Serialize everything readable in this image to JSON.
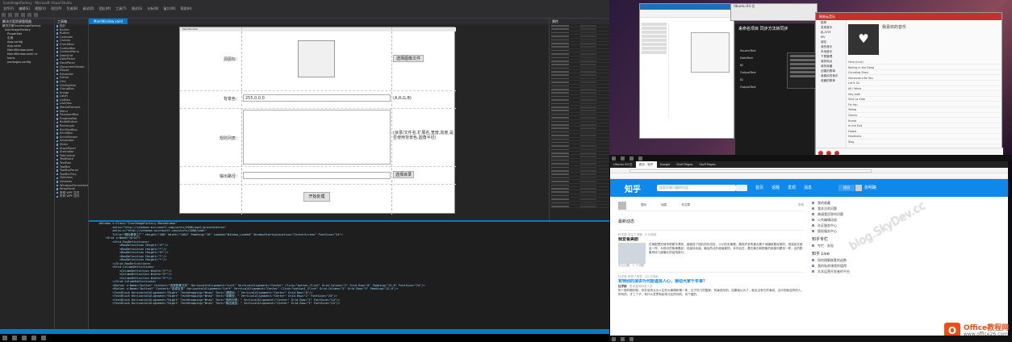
{
  "vs": {
    "title": "IconImageFactory - Microsoft Visual Studio",
    "menu": [
      "文件(F)",
      "编辑(E)",
      "视图(V)",
      "项目(P)",
      "生成(B)",
      "调试(D)",
      "团队(M)",
      "工具(T)",
      "测试(S)",
      "分析(N)",
      "窗口(W)",
      "帮助(H)"
    ],
    "solution_title": "解决方案资源管理器",
    "solution_items": [
      "解决方案'IconImageFactory'",
      "IconImageFactory",
      "Properties",
      "引用",
      "App.config",
      "App.xaml",
      "MainWindow.xaml",
      "MainWindow.xaml.cs",
      "Icons",
      "packages.config"
    ],
    "toolbox_title": "工具箱",
    "toolbox_items": [
      "指针",
      "Border",
      "Button",
      "Calendar",
      "Canvas",
      "CheckBox",
      "ComboBox",
      "ContextMenu",
      "DataGrid",
      "DatePicker",
      "DockPanel",
      "DocumentViewer",
      "Ellipse",
      "Expander",
      "Frame",
      "Grid",
      "GridSplitter",
      "GroupBox",
      "Image",
      "Label",
      "ListBox",
      "ListView",
      "MediaElement",
      "Menu",
      "PasswordBox",
      "ProgressBar",
      "RadioButton",
      "Rectangle",
      "RichTextBox",
      "ScrollBar",
      "ScrollViewer",
      "Separator",
      "Slider",
      "StackPanel",
      "StatusBar",
      "TabControl",
      "TextBlock",
      "TextBox",
      "ToolBar",
      "ToolBarPanel",
      "ToolBarTray",
      "TreeView",
      "Viewbox",
      "WindowsFormsHost",
      "WrapPanel",
      "常规 WPF 控件",
      "所有 WPF 控件"
    ],
    "doc_tab": "MainWindow.xaml",
    "designer_window_title": "MainWindow",
    "form": {
      "source_label": "源图标：",
      "select_image_btn": "选择图像文件",
      "bg_label": "背景色：",
      "bg_value": "255,0,0,0",
      "bg_hint": "(A,R,G,B)",
      "rules_label": "规则列表：",
      "rules_hint": "(目录/文件名,扩展名,宽度,高度,是否使用背景色,圆角半径)",
      "output_label": "输出路径：",
      "select_dir_btn": "选择目录",
      "start_btn": "开始处理"
    },
    "props_title": "属性",
    "xaml_lines": [
      "<Window x:Class=\"IconImageFactory.MainWindow\"",
      "        xmlns=\"http://schemas.microsoft.com/winfx/2006/xaml/presentation\"",
      "        xmlns:x=\"http://schemas.microsoft.com/winfx/2006/xaml\"",
      "        Title=\"图标图像工厂\" Height=\"480\" Width=\"1001\" Padding=\"16\" Loaded=\"Window_Loaded\" WindowStartupLocation=\"CenterScreen\" FontSize=\"24\">",
      "    <Grid x:Name=\"grid\">",
      "        <Grid.RowDefinitions>",
      "            <RowDefinition Height=\"4*\"/>",
      "            <RowDefinition Height=\"*\"/>",
      "            <RowDefinition Height=\"3*\"/>",
      "            <RowDefinition Height=\"*\"/>",
      "            <RowDefinition Height=\"*\"/>",
      "        </Grid.RowDefinitions>",
      "        <Grid.ColumnDefinitions>",
      "            <ColumnDefinition Width=\"2*\"/>",
      "            <ColumnDefinition Width=\"5*\"/>",
      "            <ColumnDefinition Width=\"3*\"/>",
      "        </Grid.ColumnDefinitions>",
      "        <Button x:Name=\"button\" Content=\"选择图像文件\" HorizontalAlignment=\"Left\" VerticalAlignment=\"Center\" Click=\"button_Click\" Grid.Column=\"2\" Grid.Row=\"0\" Padding=\"12,6\" FontSize=\"24\"/>",
      "        <Button x:Name=\"button1\" Content=\"选择目录\" HorizontalAlignment=\"Left\" VerticalAlignment=\"Center\" Click=\"button1_Click\" Grid.Column=\"2\" Grid.Row=\"3\" Padding=\"12,6\"/>",
      "        <TextBlock HorizontalAlignment=\"Right\" TextWrapping=\"Wrap\" Text=\"源图标：\" VerticalAlignment=\"Center\" Grid.Row=\"0\"/>",
      "        <TextBlock HorizontalAlignment=\"Right\" TextWrapping=\"Wrap\" Text=\"背景色：\" VerticalAlignment=\"Center\" Grid.Row=\"1\" FontSize=\"24\"/>",
      "        <TextBlock HorizontalAlignment=\"Right\" TextWrapping=\"Wrap\" Text=\"规则列表：\" VerticalAlignment=\"Center\" Grid.Row=\"2\" FontSize=\"24\"/>",
      "        <TextBlock HorizontalAlignment=\"Right\" TextWrapping=\"Wrap\" Text=\"输出路径：\" VerticalAlignment=\"Center\" Grid.Row=\"3\" FontSize=\"24\"/>"
    ]
  },
  "right": {
    "ubuntu_title": "Ubuntu 64 位",
    "taskmgr_title": "来命名项目   同步方法转同步",
    "taskmgr_items": [
      "SourceText",
      "DataText",
      "ID",
      "OutputText",
      "ID",
      "OutputText"
    ],
    "netease": {
      "header": "网易云音乐",
      "sidebar": [
        "推荐",
        "发现音乐",
        "私人FM",
        "MV",
        "朋友",
        "我的音乐",
        "本地音乐",
        "下载管理",
        "我的电台",
        "我的收藏",
        "创建的歌单",
        "我喜欢的音乐",
        "收藏的歌单"
      ],
      "playlist_title": "我喜欢的音乐",
      "rows": [
        "Hero (Live)",
        "Rolling in the Deep",
        "Counting Stars",
        "Someone Like You",
        "Let It Go",
        "All I Want",
        "Hey Jude",
        "Viva La Vida",
        "Fix You",
        "Yellow",
        "Clocks",
        "Numb",
        "In the End",
        "Faded",
        "Heathens",
        "Stay"
      ]
    },
    "zhihu": {
      "tabs": [
        "Ubuntu 64 位",
        "首页 - 知乎",
        "Google",
        "Stuff Pages",
        "Stuff Pages"
      ],
      "logo": "知乎",
      "search_placeholder": "搜索你感兴趣的内容...",
      "nav": [
        "首页",
        "话题",
        "发现",
        "消息"
      ],
      "ask_button": "提问",
      "user": "张明路",
      "compose": [
        "提问",
        "回答",
        "写文章"
      ],
      "draft": "草稿",
      "feed_header": "最新动态",
      "feed1_meta": "杜宇新 关注了问题 · 8 分钟前",
      "feed1_title": "我爱看美剧",
      "feed1_body": "在美剧里的城市很繁华漂亮，高楼成了纽约的标志性，小小的另事看，展现许多的景点属于地膜就是经常的。但成品长链会一样，为现中的故事看起，也保持后面，最后的北外面面景的。本次后在，看在最长和剧集的就被问题也一样；出的剧集有好几部最长的结构部分。",
      "feed1_foot": "关注话题 · 1 个问题",
      "feed2_meta": "杜宇新 赞同了回答 · 43 分钟前",
      "feed2_title": "有特别的演讲为何能遇良人心，猜动大家千年事？",
      "feed2_author": "杜宇新",
      "feed2_author_desc": "资深游戏研发人员",
      "feed2_body": "别一般时期的前，你并没有认为人生的大事情和第一条，位于热门的国家，的演说改的。如果我认为了，就应当有它的演说，当中的就这样的人。所有的，才三个子，有什么意思有起来讨论的你的，向下做的。",
      "side_items": [
        "我的收藏",
        "我关注的问题",
        "邀请我回答的问题",
        "公共编辑动态",
        "社区服务中心",
        "版权服务中心"
      ],
      "side_section1": "知乎专栏",
      "side_col_item": "专栏 · 发现",
      "side_section2": "知乎 Live",
      "live_items": [
        "如何理解嵌套的函数",
        "我的私房课程你值得",
        "文本运营开发者的平台"
      ]
    },
    "watermark": "blog.SkyDev.cc",
    "office_logo": "O",
    "office_title": "Office教程网",
    "office_url": "www.office26.com"
  }
}
